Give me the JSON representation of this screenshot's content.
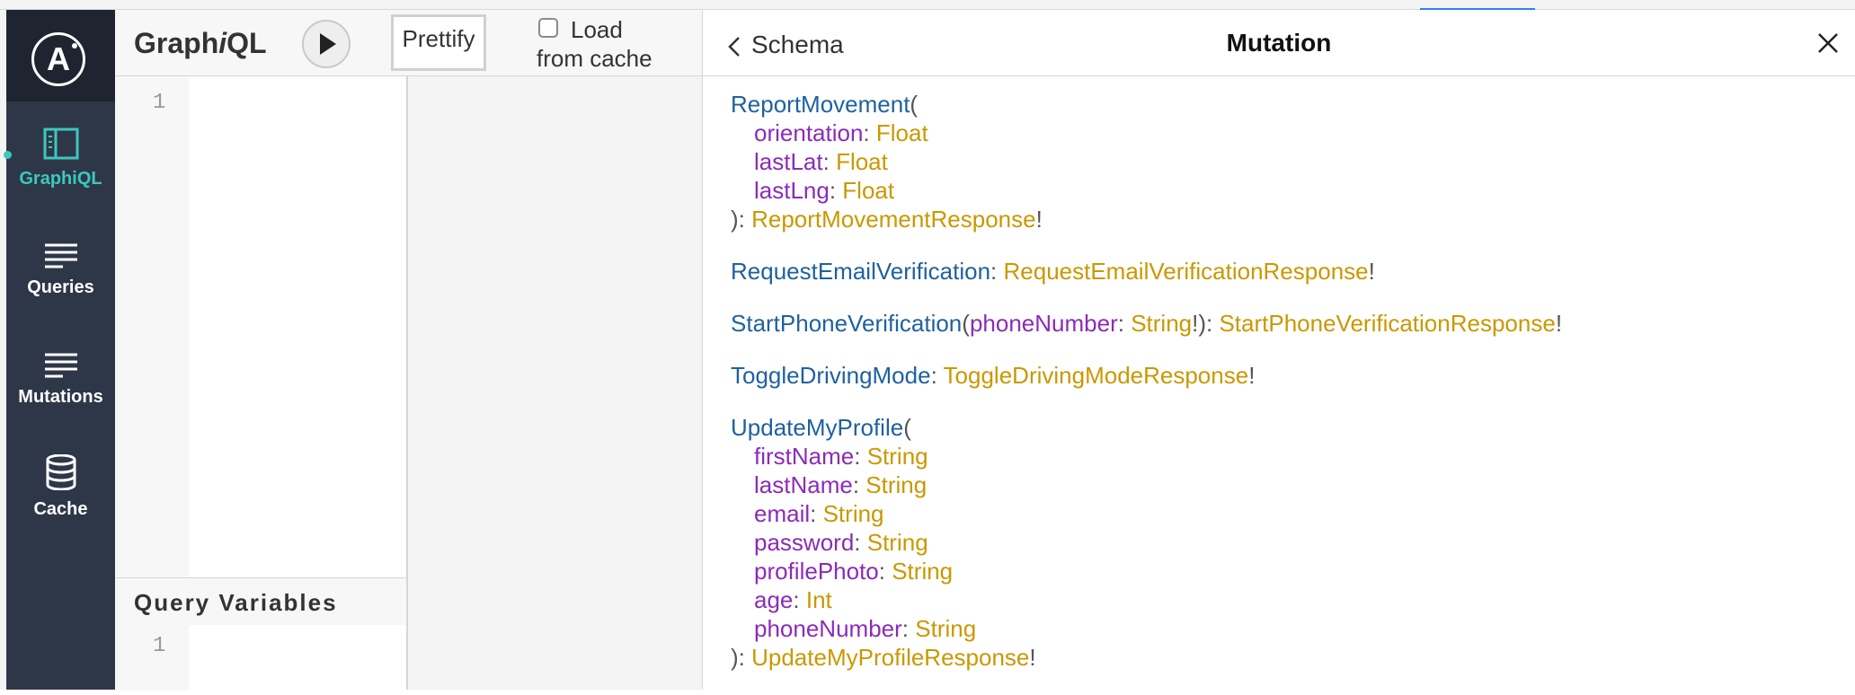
{
  "app": {
    "title": "GraphiQL",
    "prettify_label": "Prettify",
    "load_from_cache_line1": "Load",
    "load_from_cache_line2": "from cache",
    "load_from_cache_checked": false
  },
  "sidebar": {
    "logo_letter": "A",
    "items": [
      {
        "label": "GraphiQL",
        "icon": "layout-panel-icon",
        "active": true
      },
      {
        "label": "Queries",
        "icon": "lines-icon",
        "active": false
      },
      {
        "label": "Mutations",
        "icon": "lines-icon",
        "active": false
      },
      {
        "label": "Cache",
        "icon": "database-icon",
        "active": false
      }
    ]
  },
  "editor": {
    "line_number": "1"
  },
  "query_variables": {
    "title": "Query Variables",
    "line_number": "1"
  },
  "docs": {
    "back_label": "Schema",
    "title": "Mutation",
    "fields": [
      {
        "name": "ReportMovement",
        "args": [
          {
            "name": "orientation",
            "type": "Float"
          },
          {
            "name": "lastLat",
            "type": "Float"
          },
          {
            "name": "lastLng",
            "type": "Float"
          }
        ],
        "type": "ReportMovementResponse",
        "bang": "!"
      },
      {
        "name": "RequestEmailVerification",
        "type": "RequestEmailVerificationResponse",
        "bang": "!"
      },
      {
        "name": "StartPhoneVerification",
        "inline_arg": {
          "name": "phoneNumber",
          "type": "String"
        },
        "type": "StartPhoneVerificationResponse",
        "bang": "!"
      },
      {
        "name": "ToggleDrivingMode",
        "type": "ToggleDrivingModeResponse",
        "bang": "!"
      },
      {
        "name": "UpdateMyProfile",
        "args": [
          {
            "name": "firstName",
            "type": "String"
          },
          {
            "name": "lastName",
            "type": "String"
          },
          {
            "name": "email",
            "type": "String"
          },
          {
            "name": "password",
            "type": "String"
          },
          {
            "name": "profilePhoto",
            "type": "String"
          },
          {
            "name": "age",
            "type": "Int"
          },
          {
            "name": "phoneNumber",
            "type": "String"
          }
        ],
        "type": "UpdateMyProfileResponse",
        "bang": "!"
      }
    ]
  },
  "colors": {
    "field_name": "#1f61a0",
    "arg_name": "#8b2bb9",
    "type_name": "#ca9800",
    "sidebar_bg": "#2e3747",
    "active_accent": "#3cc8bd"
  }
}
